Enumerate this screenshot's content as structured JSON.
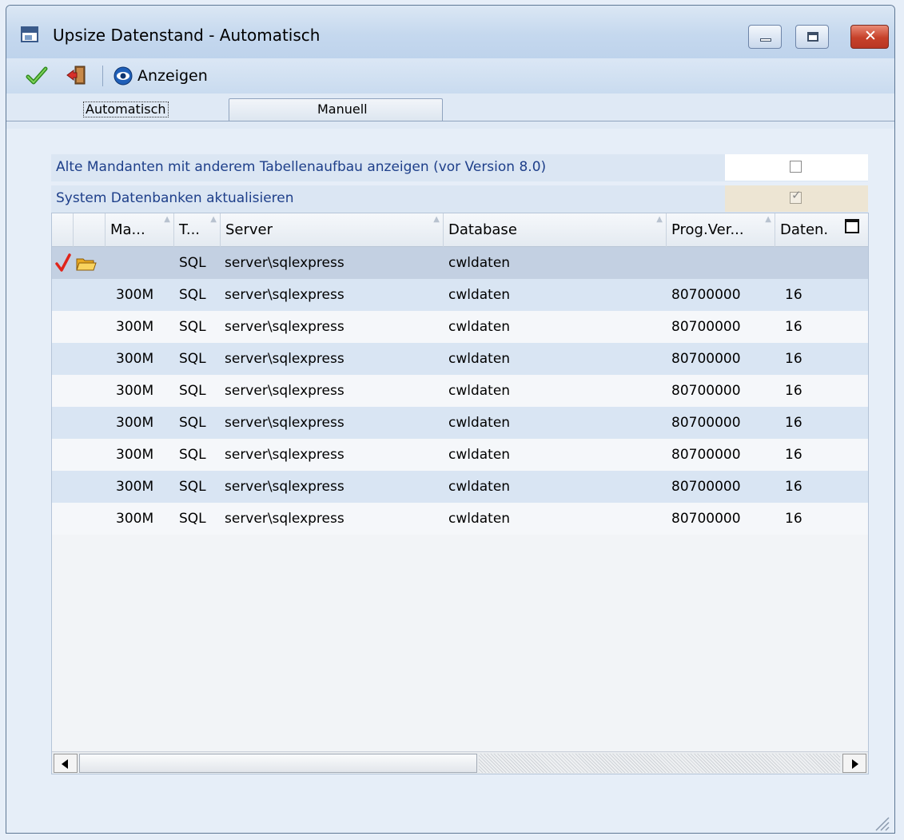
{
  "window": {
    "title": "Upsize Datenstand - Automatisch"
  },
  "toolbar": {
    "show_label": "Anzeigen"
  },
  "tabs": [
    {
      "label": "Automatisch",
      "active": true
    },
    {
      "label": "Manuell",
      "active": false
    }
  ],
  "options": [
    {
      "label": "Alte Mandanten mit anderem Tabellenaufbau anzeigen (vor Version 8.0)",
      "checked": false
    },
    {
      "label": "System Datenbanken aktualisieren",
      "checked": true
    }
  ],
  "grid": {
    "columns": [
      "Ma...",
      "T...",
      "Server",
      "Database",
      "Prog.Ver...",
      "Daten."
    ],
    "header_row": {
      "type": "SQL",
      "server": "server\\sqlexpress",
      "database": "cwldaten"
    },
    "rows": [
      {
        "mandant": "300M",
        "type": "SQL",
        "server": "server\\sqlexpress",
        "database": "cwldaten",
        "prog": "80700000",
        "daten": "16"
      },
      {
        "mandant": "300M",
        "type": "SQL",
        "server": "server\\sqlexpress",
        "database": "cwldaten",
        "prog": "80700000",
        "daten": "16"
      },
      {
        "mandant": "300M",
        "type": "SQL",
        "server": "server\\sqlexpress",
        "database": "cwldaten",
        "prog": "80700000",
        "daten": "16"
      },
      {
        "mandant": "300M",
        "type": "SQL",
        "server": "server\\sqlexpress",
        "database": "cwldaten",
        "prog": "80700000",
        "daten": "16"
      },
      {
        "mandant": "300M",
        "type": "SQL",
        "server": "server\\sqlexpress",
        "database": "cwldaten",
        "prog": "80700000",
        "daten": "16"
      },
      {
        "mandant": "300M",
        "type": "SQL",
        "server": "server\\sqlexpress",
        "database": "cwldaten",
        "prog": "80700000",
        "daten": "16"
      },
      {
        "mandant": "300M",
        "type": "SQL",
        "server": "server\\sqlexpress",
        "database": "cwldaten",
        "prog": "80700000",
        "daten": "16"
      },
      {
        "mandant": "300M",
        "type": "SQL",
        "server": "server\\sqlexpress",
        "database": "cwldaten",
        "prog": "80700000",
        "daten": "16"
      }
    ]
  },
  "icons": {
    "ok": "checkmark-icon",
    "exit": "exit-door-icon",
    "show": "eye-icon",
    "row_check": "red-check-icon",
    "row_folder": "folder-icon"
  },
  "colors": {
    "accent": "#1e3f8a",
    "row_alt": "#d9e5f3",
    "row_selected": "#c3d0e2",
    "close_button": "#c6412a"
  }
}
